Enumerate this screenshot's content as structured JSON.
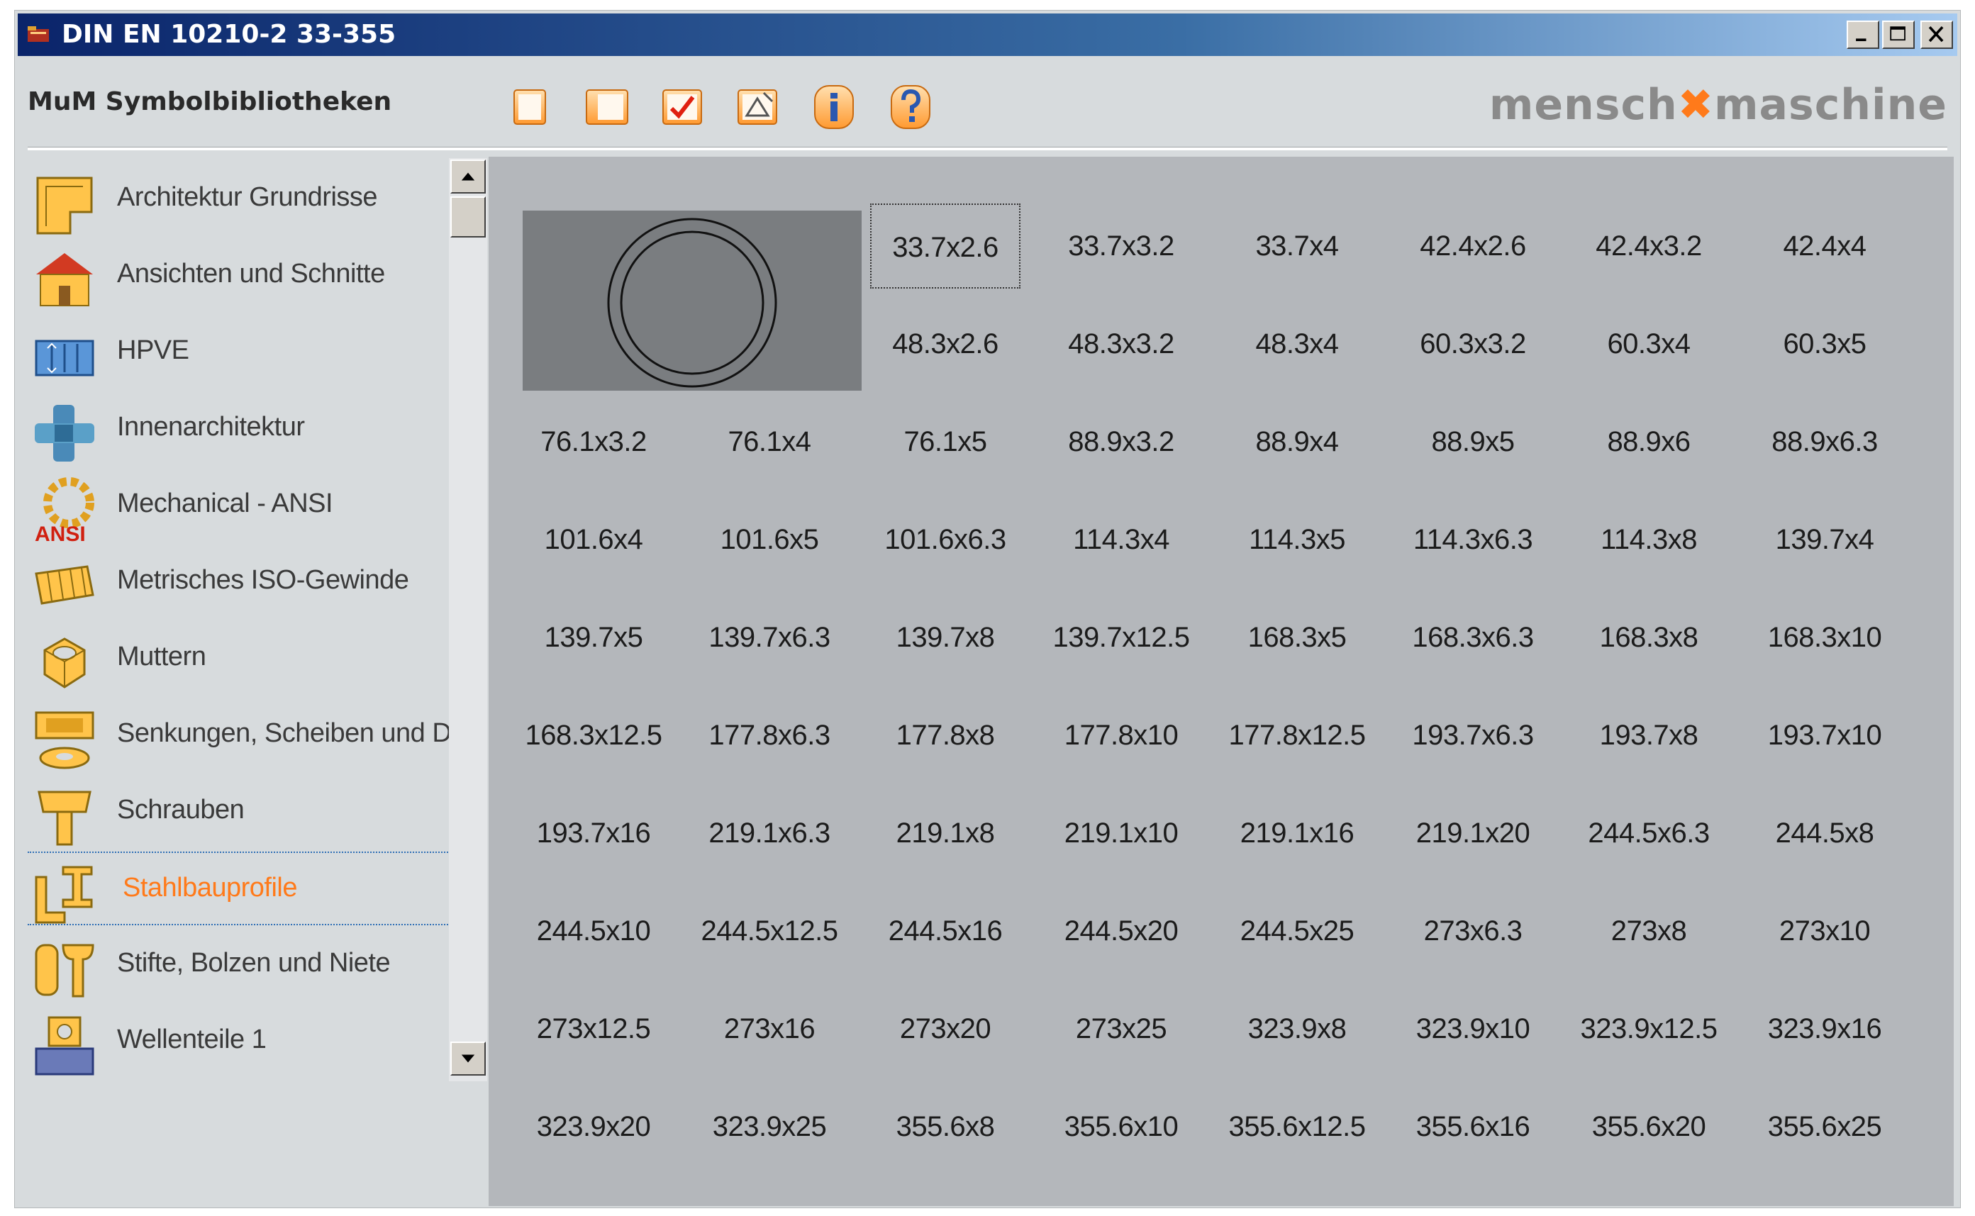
{
  "window": {
    "title": "DIN EN 10210-2 33-355",
    "controls": [
      "minimize",
      "maximize",
      "close"
    ]
  },
  "header": {
    "library_title": "MuM Symbolbibliotheken",
    "toolbar_icons": [
      "rectangle-icon",
      "half-rectangle-icon",
      "checkmark-icon",
      "attribute-icon",
      "info-icon",
      "help-icon"
    ],
    "logo": {
      "left": "mensch",
      "mark": "✖",
      "right": "maschine"
    }
  },
  "sidebar": {
    "items": [
      {
        "label": "Architektur Grundrisse",
        "icon": "floorplan-icon"
      },
      {
        "label": "Ansichten und Schnitte",
        "icon": "house-icon"
      },
      {
        "label": "HPVE",
        "icon": "hpve-icon"
      },
      {
        "label": "Innenarchitektur",
        "icon": "furniture-icon"
      },
      {
        "label": "Mechanical - ANSI",
        "icon": "gear-ansi-icon",
        "badge": "ANSI"
      },
      {
        "label": "Metrisches ISO-Gewinde",
        "icon": "thread-icon"
      },
      {
        "label": "Muttern",
        "icon": "nut-icon"
      },
      {
        "label": "Senkungen, Scheiben und Du",
        "icon": "washer-icon"
      },
      {
        "label": "Schrauben",
        "icon": "screw-icon"
      },
      {
        "label": "Stahlbauprofile",
        "icon": "steel-profile-icon",
        "selected": true
      },
      {
        "label": "Stifte, Bolzen und Niete",
        "icon": "pin-icon"
      },
      {
        "label": "Wellenteile 1",
        "icon": "shaft-icon"
      }
    ]
  },
  "grid": {
    "focused": "33.7x2.6",
    "row1": [
      "33.7x2.6",
      "33.7x3.2",
      "33.7x4",
      "42.4x2.6",
      "42.4x3.2",
      "42.4x4"
    ],
    "row2": [
      "48.3x2.6",
      "48.3x3.2",
      "48.3x4",
      "60.3x3.2",
      "60.3x4",
      "60.3x5"
    ],
    "rows": [
      [
        "76.1x3.2",
        "76.1x4",
        "76.1x5",
        "88.9x3.2",
        "88.9x4",
        "88.9x5",
        "88.9x6",
        "88.9x6.3"
      ],
      [
        "101.6x4",
        "101.6x5",
        "101.6x6.3",
        "114.3x4",
        "114.3x5",
        "114.3x6.3",
        "114.3x8",
        "139.7x4"
      ],
      [
        "139.7x5",
        "139.7x6.3",
        "139.7x8",
        "139.7x12.5",
        "168.3x5",
        "168.3x6.3",
        "168.3x8",
        "168.3x10"
      ],
      [
        "168.3x12.5",
        "177.8x6.3",
        "177.8x8",
        "177.8x10",
        "177.8x12.5",
        "193.7x6.3",
        "193.7x8",
        "193.7x10"
      ],
      [
        "193.7x16",
        "219.1x6.3",
        "219.1x8",
        "219.1x10",
        "219.1x16",
        "219.1x20",
        "244.5x6.3",
        "244.5x8"
      ],
      [
        "244.5x10",
        "244.5x12.5",
        "244.5x16",
        "244.5x20",
        "244.5x25",
        "273x6.3",
        "273x8",
        "273x10"
      ],
      [
        "273x12.5",
        "273x16",
        "273x20",
        "273x25",
        "323.9x8",
        "323.9x10",
        "323.9x12.5",
        "323.9x16"
      ],
      [
        "323.9x20",
        "323.9x25",
        "355.6x8",
        "355.6x10",
        "355.6x12.5",
        "355.6x16",
        "355.6x20",
        "355.6x25"
      ]
    ]
  },
  "colors": {
    "accent": "#ff7a1a",
    "titlebar": "#0a246a",
    "panel": "#b4b7bb",
    "sidebar_bg": "#d7dbdd"
  }
}
